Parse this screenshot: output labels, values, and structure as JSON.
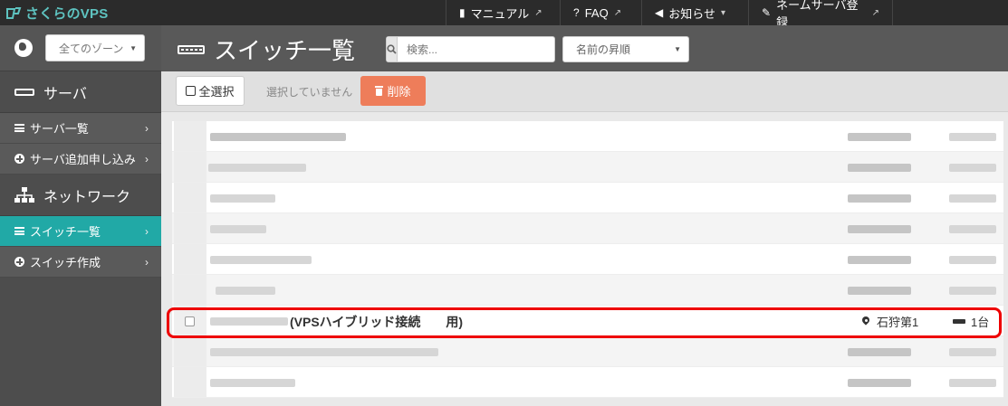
{
  "brand": {
    "logo_text": "さくらのVPS"
  },
  "topnav": {
    "manual": "マニュアル",
    "faq": "FAQ",
    "news": "お知らせ",
    "domain": "ネームサーバ登録"
  },
  "sidebar": {
    "zone_select": "全てのゾーン",
    "server_section": "サーバ",
    "server_items": [
      {
        "label": "サーバ一覧"
      },
      {
        "label": "サーバ追加申し込み"
      }
    ],
    "network_section": "ネットワーク",
    "network_items": [
      {
        "label": "スイッチ一覧",
        "active": true
      },
      {
        "label": "スイッチ作成"
      }
    ]
  },
  "header": {
    "title": "スイッチ一覧",
    "search_placeholder": "検索...",
    "sort_value": "名前の昇順"
  },
  "toolbar": {
    "select_all": "全選択",
    "selection_status": "選択していません",
    "delete": "削除"
  },
  "highlighted_row": {
    "name": "(VPSハイブリッド接続　　用)",
    "zone": "石狩第1",
    "count": "1台"
  },
  "colors": {
    "accent": "#21a9a6",
    "delete": "#ee7d5a",
    "highlight_border": "#ee0000"
  }
}
